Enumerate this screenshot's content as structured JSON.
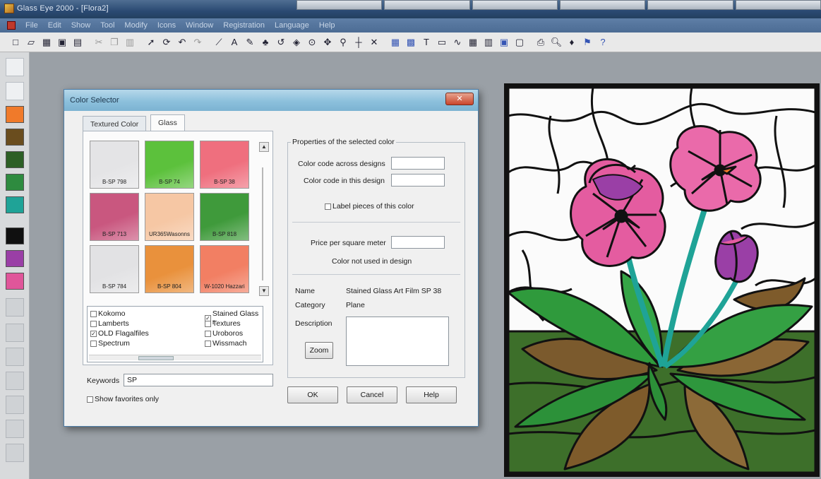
{
  "window": {
    "title": "Glass Eye 2000 - [Flora2]"
  },
  "menu": {
    "items": [
      "File",
      "Edit",
      "Show",
      "Tool",
      "Modify",
      "Icons",
      "Window",
      "Registration",
      "Language",
      "Help"
    ]
  },
  "toolbar": {
    "icons": [
      "new-icon",
      "open-icon",
      "print-icon",
      "save-icon",
      "save-all-icon",
      "cut-icon",
      "copy-icon",
      "paste-icon",
      "pointer-icon",
      "rotate-icon",
      "undo-icon",
      "redo-icon",
      "line-icon",
      "text-icon",
      "pencil-icon",
      "paint-icon",
      "rotate-left-icon",
      "fill-icon",
      "target-icon",
      "move-icon",
      "anchor-icon",
      "cross-icon",
      "delete-icon",
      "grid-icon",
      "grid2-icon",
      "text-tool-icon",
      "rect-icon",
      "measure-icon",
      "table-icon",
      "layers-icon",
      "pattern-icon",
      "frame-icon",
      "printer-icon",
      "preview-icon",
      "color-icon",
      "flag-icon",
      "help-icon"
    ]
  },
  "palette": {
    "colors": [
      "#f07a2a",
      "#6a4d1e",
      "#2d5f25",
      "#2e8b3f",
      "#1fa397",
      "#101010",
      "#9a3fa6",
      "#e0569a"
    ]
  },
  "dialog": {
    "title": "Color Selector",
    "tabs": [
      "Textured Color",
      "Glass"
    ],
    "active_tab": "Glass",
    "glass_swatches": [
      {
        "code": "B-SP 798",
        "color": "#e4e4e6"
      },
      {
        "code": "B-SP 74",
        "color": "#5cc13c"
      },
      {
        "code": "B-SP 38",
        "color": "#ef6f7e"
      },
      {
        "code": "B-SP 713",
        "color": "#c9577f"
      },
      {
        "code": "UR365Wasonns",
        "color": "#f6c7a4"
      },
      {
        "code": "B-SP 818",
        "color": "#3f9a3b"
      },
      {
        "code": "B-SP 784",
        "color": "#e2e2e4"
      },
      {
        "code": "B-SP 804",
        "color": "#e9913c"
      },
      {
        "code": "W-1020 Hazzari",
        "color": "#f27f63"
      }
    ],
    "manufacturers": [
      {
        "label": "Kokomo",
        "checked": false
      },
      {
        "label": "Stained Glass r",
        "checked": true
      },
      {
        "label": "Lamberts",
        "checked": false
      },
      {
        "label": "Textures",
        "checked": false
      },
      {
        "label": "OLD Flagalfiles",
        "checked": true
      },
      {
        "label": "Uroboros",
        "checked": false
      },
      {
        "label": "Spectrum",
        "checked": false
      },
      {
        "label": "Wissmach",
        "checked": false
      }
    ],
    "keywords_label": "Keywords",
    "keywords_value": "SP",
    "show_favorites_label": "Show favorites only",
    "properties": {
      "group_title": "Properties of the selected color",
      "code_across_label": "Color code across designs",
      "code_in_design_label": "Color code in this design",
      "label_pieces_label": "Label pieces of this color",
      "price_label": "Price per square meter",
      "not_used_label": "Color not used in design",
      "name_label": "Name",
      "name_value": "Stained Glass Art Film SP 38",
      "category_label": "Category",
      "category_value": "Plane",
      "description_label": "Description",
      "zoom_label": "Zoom"
    },
    "buttons": {
      "ok": "OK",
      "cancel": "Cancel",
      "help": "Help"
    }
  }
}
